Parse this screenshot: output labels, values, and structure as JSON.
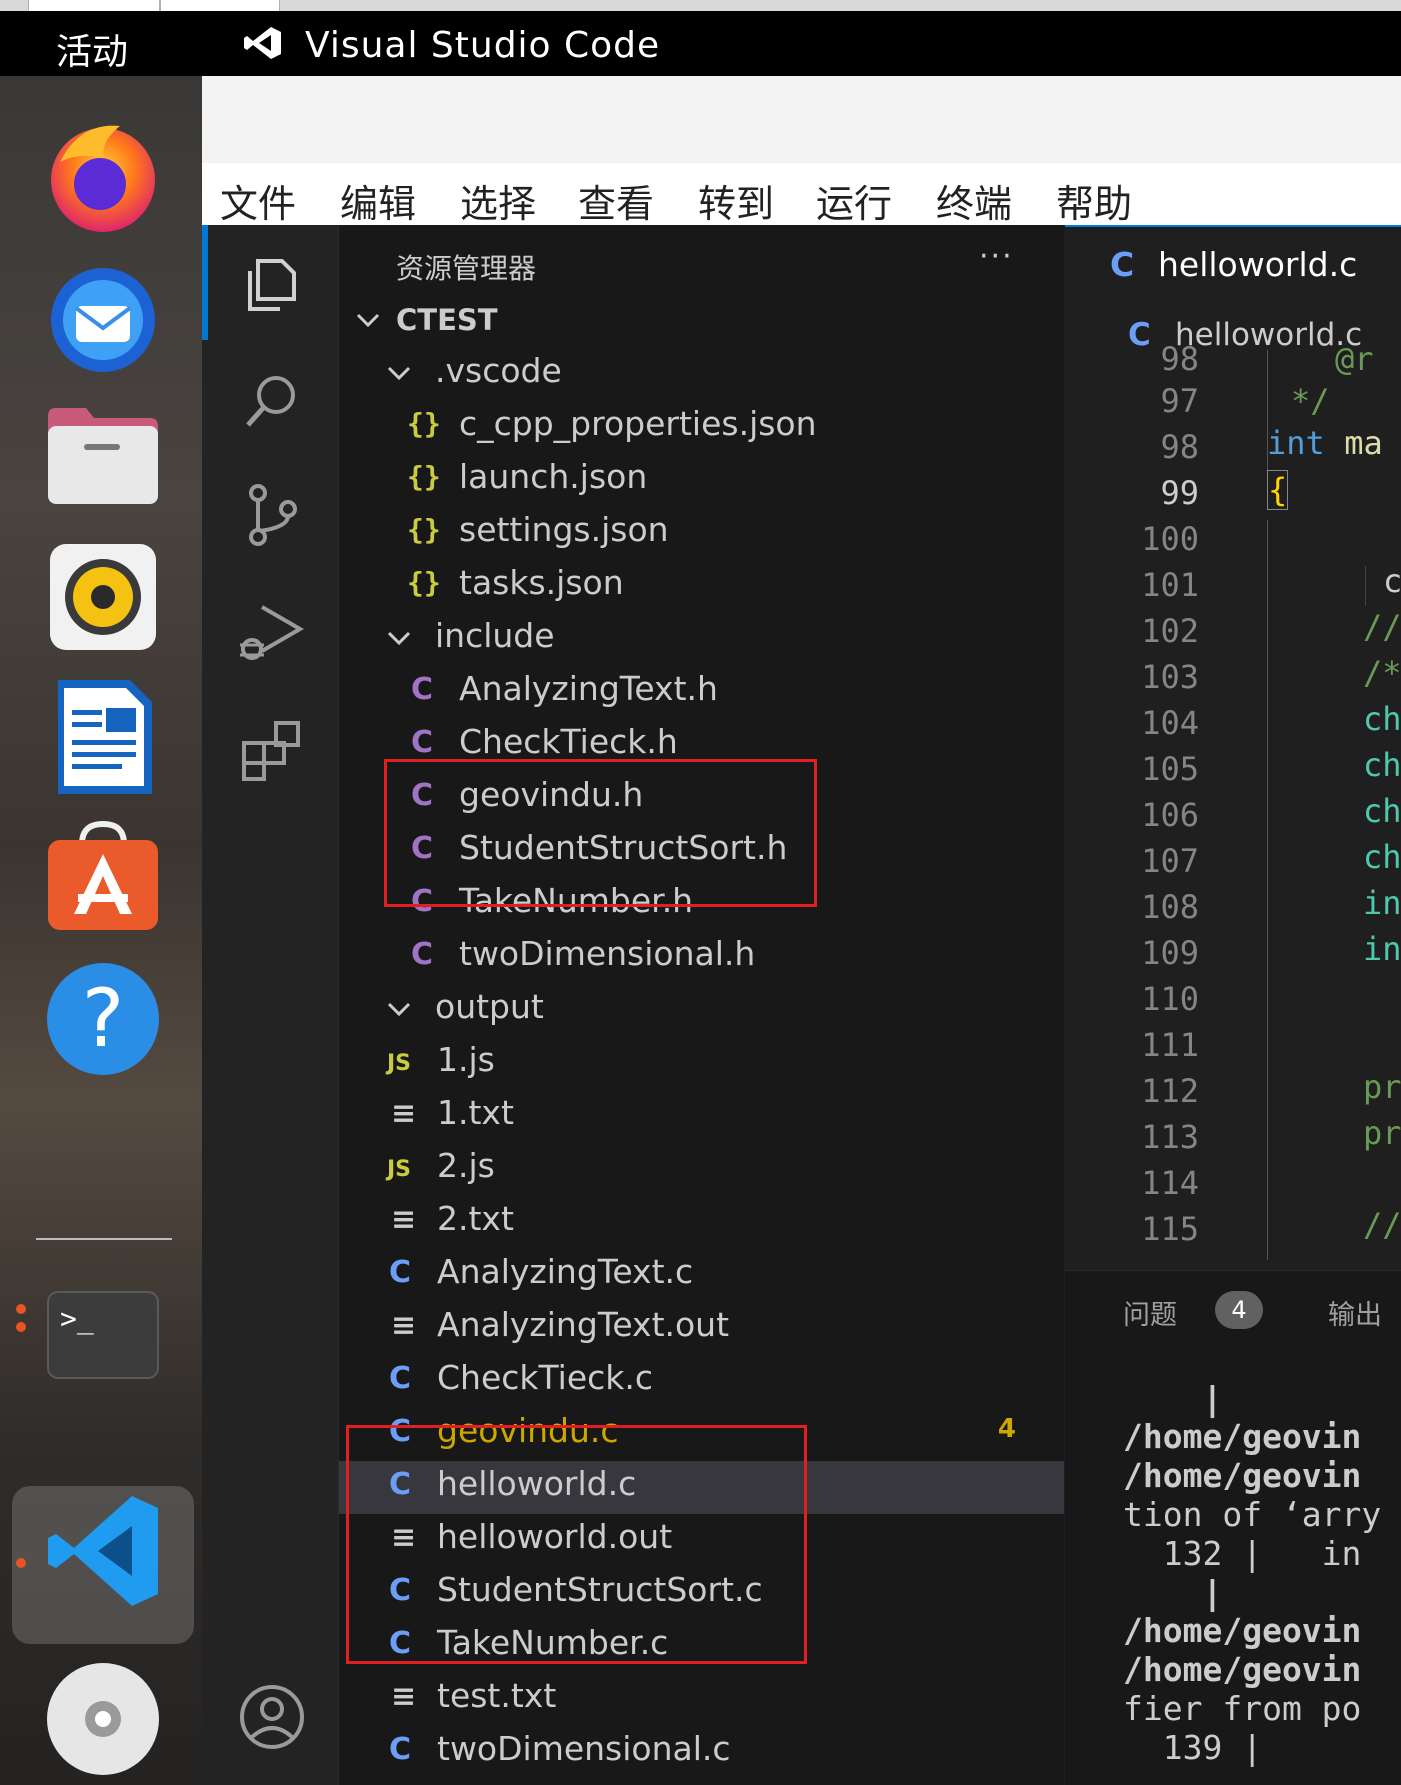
{
  "topbar": {
    "activities": "活动",
    "app_title": "Visual Studio Code"
  },
  "menu": [
    "文件",
    "编辑",
    "选择",
    "查看",
    "转到",
    "运行",
    "终端",
    "帮助"
  ],
  "explorer": {
    "title": "资源管理器",
    "more": "···",
    "root": "CTEST",
    "folder_vscode": ".vscode",
    "vscode_files": [
      "c_cpp_properties.json",
      "launch.json",
      "settings.json",
      "tasks.json"
    ],
    "folder_include": "include",
    "include_files": [
      "AnalyzingText.h",
      "CheckTieck.h",
      "geovindu.h",
      "StudentStructSort.h",
      "TakeNumber.h",
      "twoDimensional.h"
    ],
    "folder_output": "output",
    "output_files": [
      "1.js",
      "1.txt",
      "2.js",
      "2.txt",
      "AnalyzingText.c",
      "AnalyzingText.out",
      "CheckTieck.c",
      "geovindu.c",
      "helloworld.c",
      "helloworld.out",
      "StudentStructSort.c",
      "TakeNumber.c",
      "test.txt",
      "twoDimensional.c"
    ],
    "geovindu_problems": "4"
  },
  "editor": {
    "tab_label": "helloworld.c",
    "breadcrumb": "helloworld.c",
    "line_numbers": [
      "98",
      "97",
      "98",
      "99",
      "100",
      "101",
      "102",
      "103",
      "104",
      "105",
      "106",
      "107",
      "108",
      "109",
      "110",
      "111",
      "112",
      "113",
      "114",
      "115"
    ],
    "code": {
      "l96": "@r",
      "l97": "*/",
      "l98_kw": "int",
      "l98_rest": " ma",
      "l99": "{",
      "l101": "c",
      "l102": "//",
      "l103": "/*",
      "l104": "ch",
      "l105": "ch",
      "l106": "ch",
      "l107": "ch",
      "l108": "in",
      "l109": "in",
      "l112": "pr",
      "l113": "pr",
      "l115": "//"
    }
  },
  "panel": {
    "problems_label": "问题",
    "problems_count": "4",
    "output_label": "输出",
    "terminal_lines": [
      "    |",
      "/home/geovin",
      "/home/geovin",
      "tion of ‘arry",
      "  132 |   in",
      "    |",
      "/home/geovin",
      "/home/geovin",
      "fier from po",
      "  139 |"
    ]
  },
  "colors": {
    "accent": "#0078d4",
    "highlight_box": "#e02020",
    "warning": "#cca700",
    "c_icon": "#6c9ef8",
    "json_icon": "#cbcb41"
  }
}
